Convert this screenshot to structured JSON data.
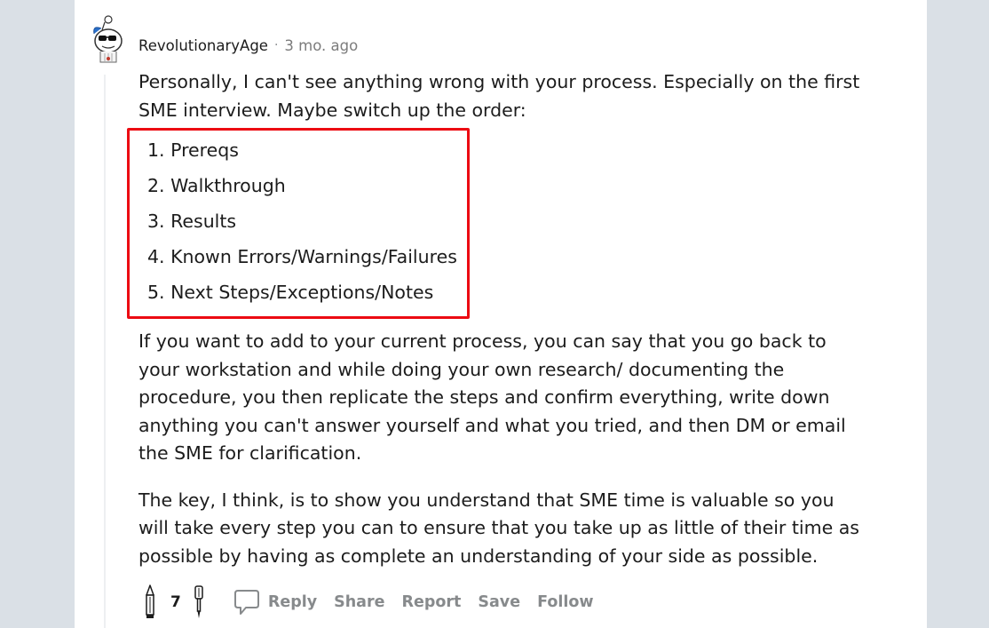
{
  "comment": {
    "author": "RevolutionaryAge",
    "separator": "·",
    "timestamp": "3 mo. ago",
    "avatar_icon": "snoo-sunglasses-avatar-icon",
    "intro": "Personally, I can't see anything wrong with your process. Especially on the first SME interview. Maybe switch up the order:",
    "list": [
      "1. Prereqs",
      "2. Walkthrough",
      "3. Results",
      "4. Known Errors/Warnings/Failures",
      "5. Next Steps/Exceptions/Notes"
    ],
    "paragraph_2": "If you want to add to your current process, you can say that you go back to your workstation and while doing your own research/ documenting the procedure, you then replicate the steps and confirm everything, write down anything you can't answer yourself and what you tried, and then DM or email the SME for clarification.",
    "paragraph_3": "The key, I think, is to show you understand that SME time is valuable so you will take every step you can to ensure that you take up as little of their time as possible by having as complete an understanding of your side as possible."
  },
  "highlight_color": "#ec0b12",
  "actions": {
    "upvote_icon": "pencil-upvote-icon",
    "vote_count": "7",
    "downvote_icon": "screwdriver-downvote-icon",
    "reply_icon": "speech-bubble-icon",
    "reply": "Reply",
    "share": "Share",
    "report": "Report",
    "save": "Save",
    "follow": "Follow"
  }
}
